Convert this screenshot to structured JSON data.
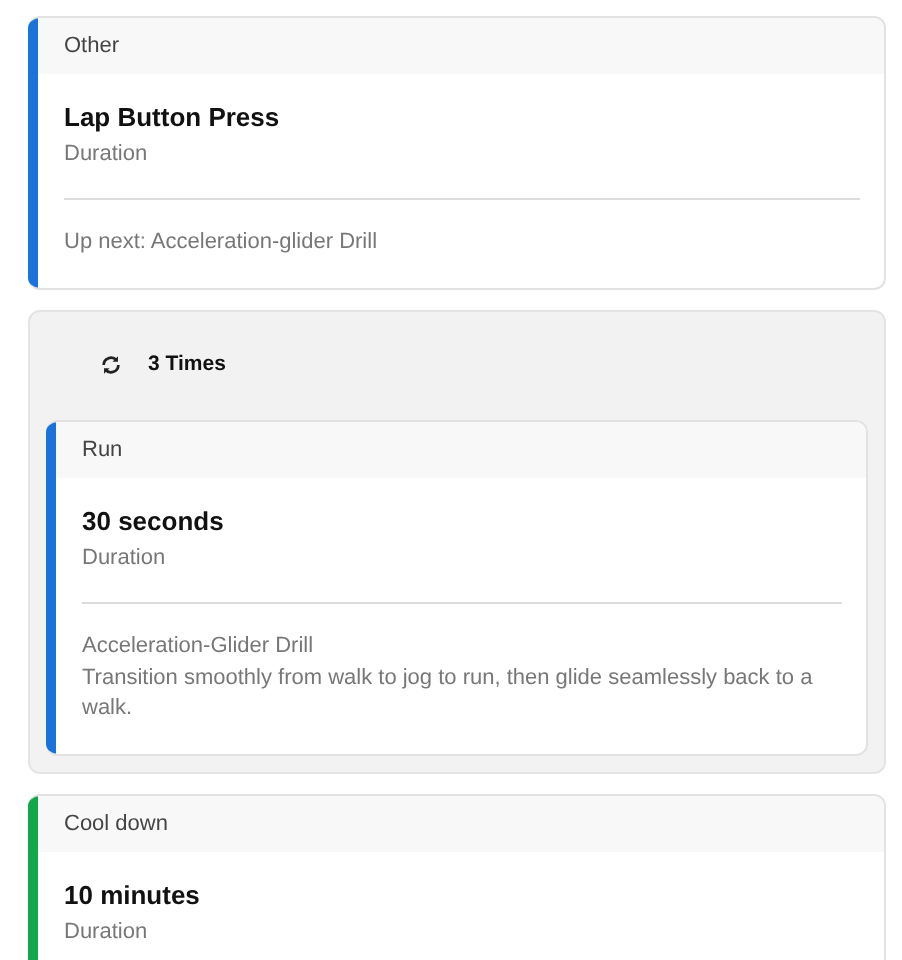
{
  "steps": [
    {
      "kind": "step",
      "category": "Other",
      "color": "#1a73d9",
      "title": "Lap Button Press",
      "subtitle": "Duration",
      "notes": [
        "Up next: Acceleration-glider Drill"
      ]
    },
    {
      "kind": "repeat",
      "label": "3 Times",
      "steps": [
        {
          "kind": "step",
          "category": "Run",
          "color": "#1a73d9",
          "title": "30 seconds",
          "subtitle": "Duration",
          "notes": [
            "Acceleration-Glider Drill",
            "Transition smoothly from walk to jog to run, then glide seamlessly back to a walk."
          ]
        }
      ]
    },
    {
      "kind": "step",
      "category": "Cool down",
      "color": "#12a84a",
      "title": "10 minutes",
      "subtitle": "Duration"
    }
  ]
}
